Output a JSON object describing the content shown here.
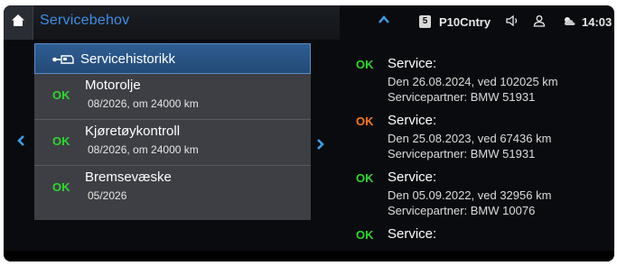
{
  "header": {
    "title": "Servicebehov",
    "station_number": "5",
    "station_name": "P10Cntry",
    "time": "14:03"
  },
  "colors": {
    "accent_blue": "#3d8fe6",
    "ok_green": "#2fd62f",
    "warn_orange": "#ff7a1a",
    "panel_gray": "#3d3f44",
    "selected_blue": "#2e5d92"
  },
  "icons": {
    "home": "home-icon",
    "history": "car-key-icon",
    "scroll_up": "chevron-up-icon",
    "speaker": "speaker-icon",
    "profile": "person-icon",
    "weather": "weather-icon",
    "nav_left": "chevron-left-icon",
    "nav_right": "chevron-right-icon"
  },
  "left_panel": {
    "history_label": "Servicehistorikk",
    "items": [
      {
        "status": "OK",
        "title": "Motorolje",
        "detail": "08/2026, om 24000 km"
      },
      {
        "status": "OK",
        "title": "Kjøretøykontroll",
        "detail": "08/2026, om 24000 km"
      },
      {
        "status": "OK",
        "title": "Bremsevæske",
        "detail": "05/2026"
      }
    ]
  },
  "right_panel": {
    "entries": [
      {
        "status": "OK",
        "status_color": "#2fd62f",
        "title": "Service:",
        "line1": "Den 26.08.2024, ved 102025 km",
        "line2": "Servicepartner: BMW 51931"
      },
      {
        "status": "OK",
        "status_color": "#ff7a1a",
        "title": "Service:",
        "line1": "Den 25.08.2023, ved 67436 km",
        "line2": "Servicepartner: BMW 51931"
      },
      {
        "status": "OK",
        "status_color": "#2fd62f",
        "title": "Service:",
        "line1": "Den 05.09.2022, ved 32956 km",
        "line2": "Servicepartner: BMW 10076"
      },
      {
        "status": "OK",
        "status_color": "#2fd62f",
        "title": "Service:",
        "line1": "",
        "line2": ""
      }
    ]
  }
}
